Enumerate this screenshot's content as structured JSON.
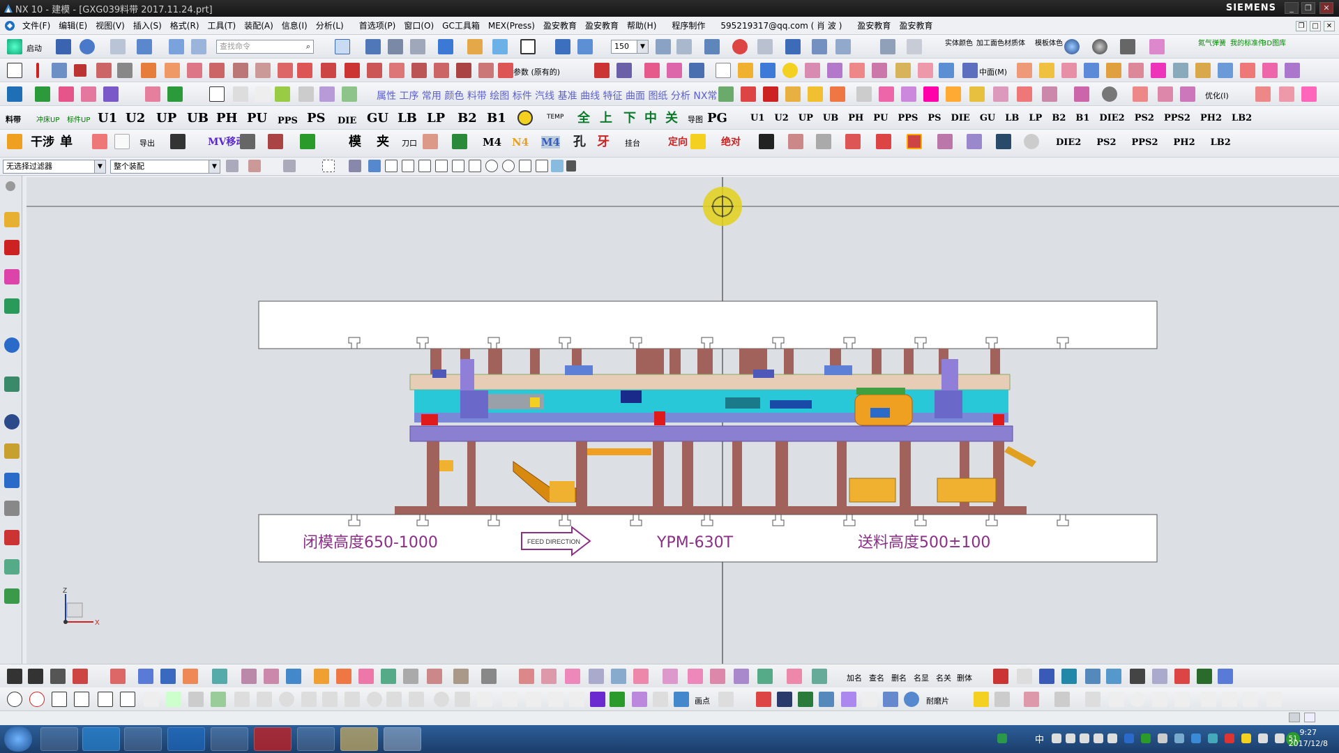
{
  "window": {
    "title": "NX 10 - 建模 - [GXG039料带 2017.11.24.prt]",
    "brand": "SIEMENS",
    "controls": [
      "_",
      "❐",
      "✕"
    ]
  },
  "menu": {
    "items": [
      "文件(F)",
      "编辑(E)",
      "视图(V)",
      "插入(S)",
      "格式(R)",
      "工具(T)",
      "装配(A)",
      "信息(I)",
      "分析(L)",
      "首选项(P)",
      "窗口(O)",
      "GC工具箱",
      "MEX(Press)",
      "盈安教育",
      "盈安教育",
      "帮助(H)",
      "程序制作",
      "595219317@qq.com ( 肖 波 )",
      "盈安教育",
      "盈安教育"
    ]
  },
  "toolbar1": {
    "start_label": "启动",
    "search_placeholder": "查找命令",
    "zoom_value": "150",
    "right_labels": [
      "实体颜色",
      "加工面色",
      "材质体",
      "模板体色",
      "氮气弹簧",
      "我的标准件",
      "3D图库"
    ]
  },
  "toolbar2": {
    "param_label": "参数 (原有的)",
    "center_label": "中面(M)"
  },
  "toolbar3": {
    "labels": [
      "属性",
      "工序",
      "常用",
      "颜色",
      "料带",
      "绘图",
      "标件",
      "汽线",
      "基准",
      "曲线",
      "特征",
      "曲面",
      "图纸",
      "分析",
      "NX常"
    ],
    "optimize_label": "优化(I)"
  },
  "toolbar4": {
    "left_labels": [
      "料带",
      "冲床UP",
      "标件UP"
    ],
    "plates": [
      "U1",
      "U2",
      "UP",
      "UB",
      "PH",
      "PU",
      "PPS",
      "PS",
      "DIE",
      "GU",
      "LB",
      "LP",
      "B2",
      "B1"
    ],
    "temp_label": "TEMP",
    "cn_labels": [
      "全",
      "上",
      "下",
      "中",
      "关"
    ],
    "map_label": "导图",
    "pg_label": "PG",
    "plates_small": [
      "U1",
      "U2",
      "UP",
      "UB",
      "PH",
      "PU",
      "PPS",
      "PS",
      "DIE",
      "GU",
      "LB",
      "LP",
      "B2",
      "B1",
      "DIE2",
      "PS2",
      "PPS2",
      "PH2",
      "LB2"
    ]
  },
  "toolbar5": {
    "labels": [
      "干涉",
      "单",
      "导出",
      "MV移动",
      "模",
      "夹",
      "刀口",
      "M4",
      "N4",
      "M4",
      "孔",
      "牙",
      "挂台",
      "定向",
      "绝对"
    ],
    "plates": [
      "DIE2",
      "PS2",
      "PPS2",
      "PH2",
      "LB2"
    ]
  },
  "selection": {
    "filter": "无选择过滤器",
    "scope": "整个装配"
  },
  "viewport": {
    "annotations": {
      "close_height": "闭模高度650-1000",
      "feed_direction": "FEED DIRECTION",
      "press_model": "YPM-630T",
      "feed_height": "送料高度500±100"
    },
    "axis_labels": {
      "z": "Z",
      "x": "X"
    }
  },
  "bottom_toolbar1": {
    "labels": [
      "加名",
      "查名",
      "删名",
      "名显",
      "名关",
      "删体"
    ]
  },
  "bottom_toolbar2": {
    "labels": [
      "画点",
      "耐磨片"
    ]
  },
  "taskbar": {
    "clock_time": "9:27",
    "clock_date": "2017/12/8",
    "ime": "中",
    "badge": "51"
  }
}
